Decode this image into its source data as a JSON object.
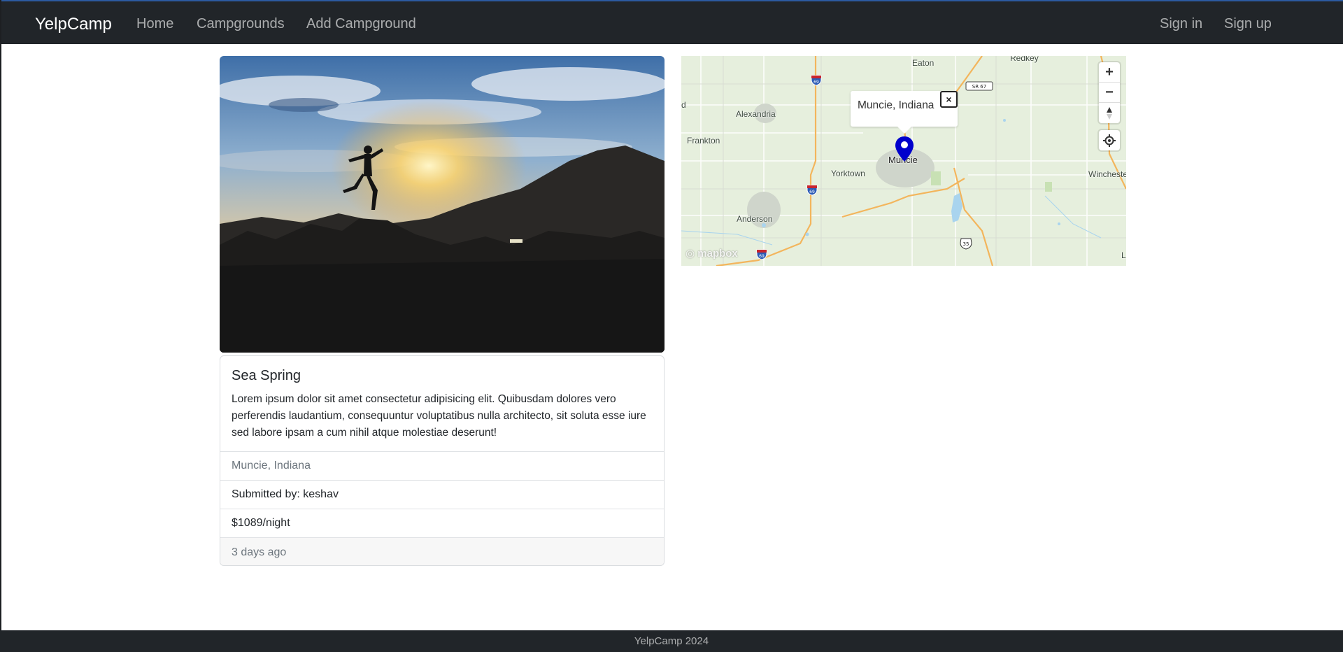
{
  "navbar": {
    "brand": "YelpCamp",
    "links": [
      "Home",
      "Campgrounds",
      "Add Campground"
    ],
    "auth": [
      "Sign in",
      "Sign up"
    ]
  },
  "campground": {
    "title": "Sea Spring",
    "description": "Lorem ipsum dolor sit amet consectetur adipisicing elit. Quibusdam dolores vero perferendis laudantium, consequuntur voluptatibus nulla architecto, sit soluta esse iure sed labore ipsam a cum nihil atque molestiae deserunt!",
    "location": "Muncie, Indiana",
    "submitted_by": "Submitted by: keshav",
    "price": "$1089/night",
    "posted": "3 days ago"
  },
  "map": {
    "popup_text": "Muncie, Indiana",
    "close_label": "×",
    "places": [
      "Eaton",
      "Redkey",
      "Alexandria",
      "Frankton",
      "Yorktown",
      "Muncie",
      "Winchester",
      "Anderson",
      "d",
      "L"
    ],
    "shields": [
      "69",
      "69",
      "69",
      "35",
      "SR 67"
    ],
    "zoom_in_label": "+",
    "zoom_out_label": "−",
    "attribution": "mapbox",
    "marker_color": "#0000cc"
  },
  "footer": {
    "text": "YelpCamp 2024"
  }
}
